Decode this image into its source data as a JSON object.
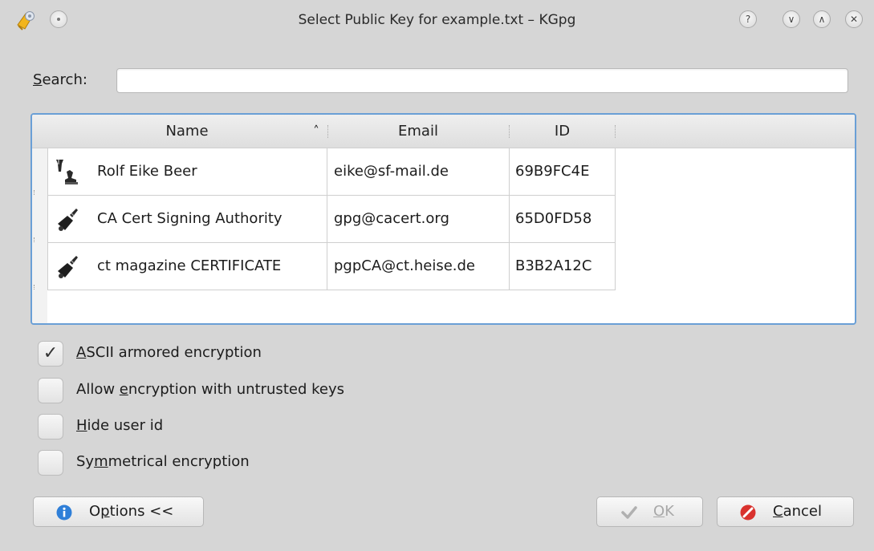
{
  "window": {
    "title": "Select Public Key for example.txt – KGpg",
    "controls": [
      "help-icon",
      "minimize-icon",
      "maximize-icon",
      "close-icon"
    ],
    "help_glyph": "?",
    "minimize_glyph": "∨",
    "maximize_glyph": "∧",
    "close_glyph": "✕"
  },
  "search": {
    "label_accel": "S",
    "label_rest": "earch:",
    "value": "",
    "placeholder": ""
  },
  "table": {
    "columns": [
      "Name",
      "Email",
      "ID"
    ],
    "sort_indicator": "˄",
    "rows": [
      {
        "icon": "key-pair-icon",
        "name": "Rolf Eike Beer",
        "email": "eike@sf-mail.de",
        "id": "69B9FC4E"
      },
      {
        "icon": "public-key-icon",
        "name": "CA Cert Signing Authority",
        "email": "gpg@cacert.org",
        "id": "65D0FD58"
      },
      {
        "icon": "public-key-icon",
        "name": "ct magazine CERTIFICATE",
        "email": "pgpCA@ct.heise.de",
        "id": "B3B2A12C"
      }
    ]
  },
  "options": [
    {
      "accel_before": "",
      "accel": "A",
      "accel_after": "SCII armored encryption",
      "checked": true
    },
    {
      "accel_before": "Allow ",
      "accel": "e",
      "accel_after": "ncryption with untrusted keys",
      "checked": false
    },
    {
      "accel_before": "",
      "accel": "H",
      "accel_after": "ide user id",
      "checked": false
    },
    {
      "accel_before": "Sy",
      "accel": "m",
      "accel_after": "metrical encryption",
      "checked": false
    }
  ],
  "check_glyph": "✓",
  "buttons": {
    "options": {
      "before": "O",
      "accel": "p",
      "after": "tions <<",
      "icon": "info-icon"
    },
    "ok": {
      "before": "",
      "accel": "O",
      "after": "K",
      "icon": "checkmark-icon",
      "disabled": true
    },
    "cancel": {
      "before": "",
      "accel": "C",
      "after": "ancel",
      "icon": "cancel-icon"
    }
  },
  "colors": {
    "accent_focus": "#6a9fd6",
    "info_blue": "#2f7fd8",
    "cancel_red": "#d9322e"
  }
}
